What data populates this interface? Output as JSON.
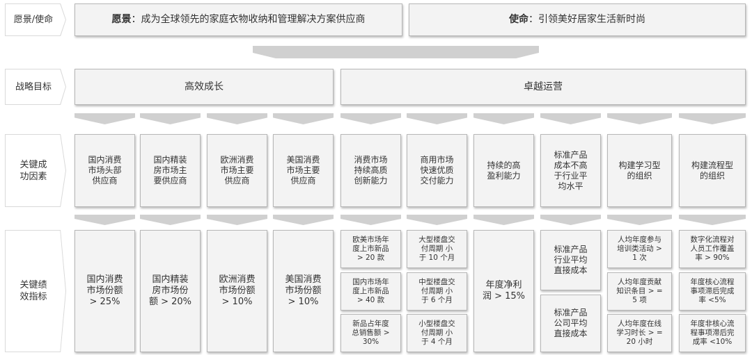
{
  "row_labels": {
    "vision_mission": "愿景/使命",
    "strategic_goals": "战略目标",
    "ksf": "关键成\n功因素",
    "kpi": "关键绩\n效指标"
  },
  "vision": {
    "label": "愿景",
    "sep": "：",
    "text": "成为全球领先的家庭衣物收纳和管理解决方案供应商"
  },
  "mission": {
    "label": "使命",
    "sep": "：",
    "text": "引领美好居家生活新时尚"
  },
  "goals": [
    "高效成长",
    "卓越运营"
  ],
  "ksf": [
    "国内消费\n市场头部\n供应商",
    "国内精装\n房市场主\n要供应商",
    "欧洲消费\n市场主要\n供应商",
    "美国消费\n市场主要\n供应商",
    "消费市场\n持续高质\n创新能力",
    "商用市场\n快速优质\n交付能力",
    "持续的高\n盈利能力",
    "标准产品\n成本不高\n于行业平\n均水平",
    "构建学习型\n的组织",
    "构建流程型\n的组织"
  ],
  "kpi": {
    "domestic_consumer": "国内消费\n市场份额\n> 25%",
    "domestic_decorated": "国内精装\n房市场份\n额 > 20%",
    "europe": "欧洲消费\n市场份额\n> 10%",
    "usa": "美国消费\n市场份额\n> 10%",
    "innovation": [
      "欧美市场年\n度上市新品\n> 20 款",
      "国内市场年\n度上市新品\n> 40 款",
      "新品占年度\n总销售额 >\n30%"
    ],
    "delivery": [
      "大型楼盘交\n付周期 小\n于 10 个月",
      "中型楼盘交\n付周期 小\n于 6 个月",
      "小型楼盘交\n付周期 小\n于 4 个月"
    ],
    "profit": "年度净利\n润 > 15%",
    "cost": [
      "标准产品\n行业平均\n直接成本",
      "标准产品\n公司平均\n直接成本"
    ],
    "learning": [
      "人均年度参与\n培训类活动 >\n1 次",
      "人均年度贡献\n知识条目 > =\n5 项",
      "人均年度在线\n学习时长 > =\n20 小时"
    ],
    "process": [
      "数字化流程对\n人员工作覆盖\n率 > 90%",
      "年度核心流程\n事项滞后完成\n率 <5%",
      "年度非核心流\n程事项滞后完\n成率 <10%"
    ]
  }
}
